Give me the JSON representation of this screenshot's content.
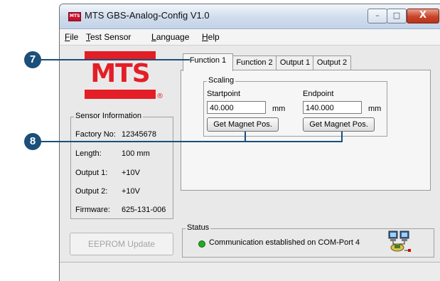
{
  "window": {
    "title": "MTS GBS-Analog-Config V1.0",
    "controls": {
      "minimize": "–",
      "maximize": "□",
      "close": "X"
    }
  },
  "menu": [
    {
      "label": "File",
      "accel": "F",
      "rest": "ile"
    },
    {
      "label": "Test Sensor",
      "accel": "T",
      "rest": "est Sensor"
    },
    {
      "label": "Language",
      "accel": "L",
      "rest": "anguage"
    },
    {
      "label": "Help",
      "accel": "H",
      "rest": "elp"
    }
  ],
  "logo": {
    "text": "MTS",
    "registered": "®"
  },
  "sensor_info": {
    "title": "Sensor Information",
    "rows": [
      {
        "label": "Factory No:",
        "value": "12345678"
      },
      {
        "label": "Length:",
        "value": "100 mm"
      },
      {
        "label": "Output 1:",
        "value": "+10V"
      },
      {
        "label": "Output 2:",
        "value": "+10V"
      },
      {
        "label": "Firmware:",
        "value": "625-131-006"
      }
    ]
  },
  "tabs": [
    "Function 1",
    "Function 2",
    "Output 1",
    "Output 2"
  ],
  "active_tab": "Function 1",
  "scaling": {
    "title": "Scaling",
    "startpoint": {
      "label": "Startpoint",
      "value": "40.000",
      "unit": "mm",
      "button": "Get Magnet Pos."
    },
    "endpoint": {
      "label": "Endpoint",
      "value": "140.000",
      "unit": "mm",
      "button": "Get Magnet Pos."
    }
  },
  "eeprom_button": "EEPROM Update",
  "status": {
    "title": "Status",
    "message": "Communication established on COM-Port 4",
    "led_color": "#22aa22"
  },
  "callouts": [
    "7",
    "8"
  ],
  "colors": {
    "brand": "#e41e26",
    "callout": "#1a4f7a"
  }
}
